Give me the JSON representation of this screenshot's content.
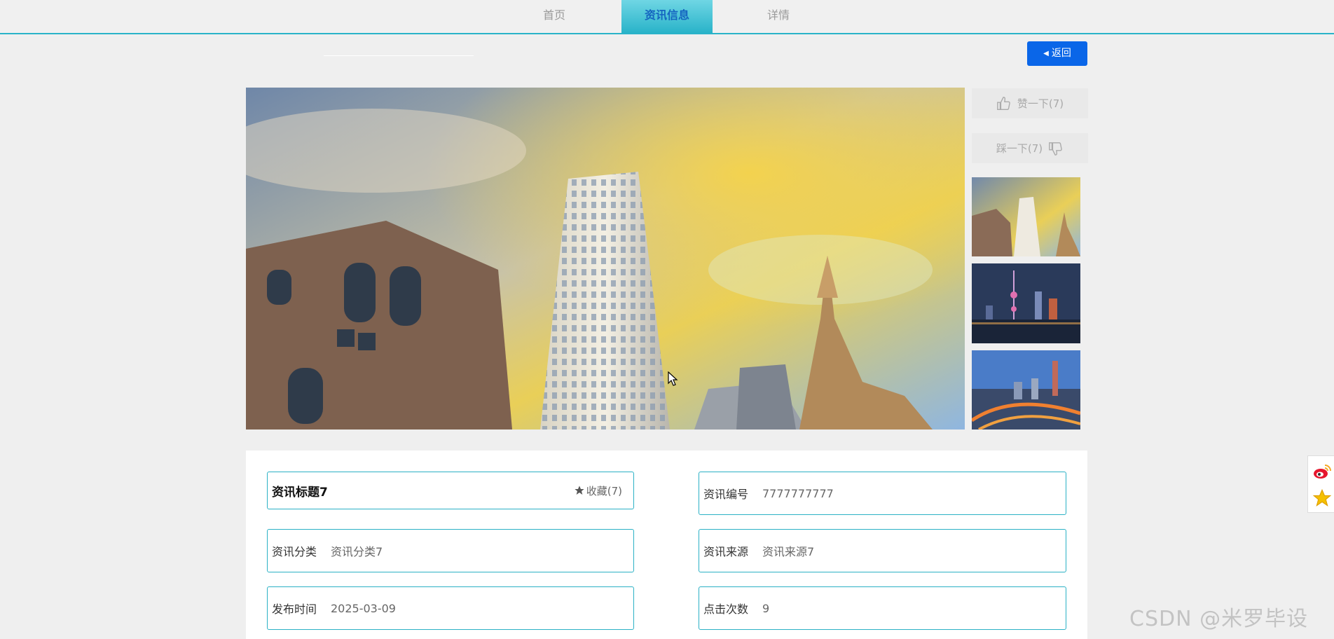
{
  "nav": {
    "items": [
      {
        "label": "首页"
      },
      {
        "label": "资讯信息"
      },
      {
        "label": "详情"
      }
    ],
    "active_color": "#29b3c9"
  },
  "back_button": {
    "label": "返回"
  },
  "votes": {
    "like_label": "赞一下(7)",
    "dislike_label": "踩一下(7)"
  },
  "detail": {
    "title": "资讯标题7",
    "favorite_label": "收藏(7)",
    "fields": {
      "id": {
        "label": "资讯编号",
        "value": "7777777777"
      },
      "category": {
        "label": "资讯分类",
        "value": "资讯分类7"
      },
      "source": {
        "label": "资讯来源",
        "value": "资讯来源7"
      },
      "publish_time": {
        "label": "发布时间",
        "value": "2025-03-09"
      },
      "clicks": {
        "label": "点击次数",
        "value": "9"
      }
    }
  },
  "watermark": "CSDN @米罗毕设",
  "colors": {
    "accent": "#29b3c9",
    "primary_button": "#0a66e8"
  }
}
